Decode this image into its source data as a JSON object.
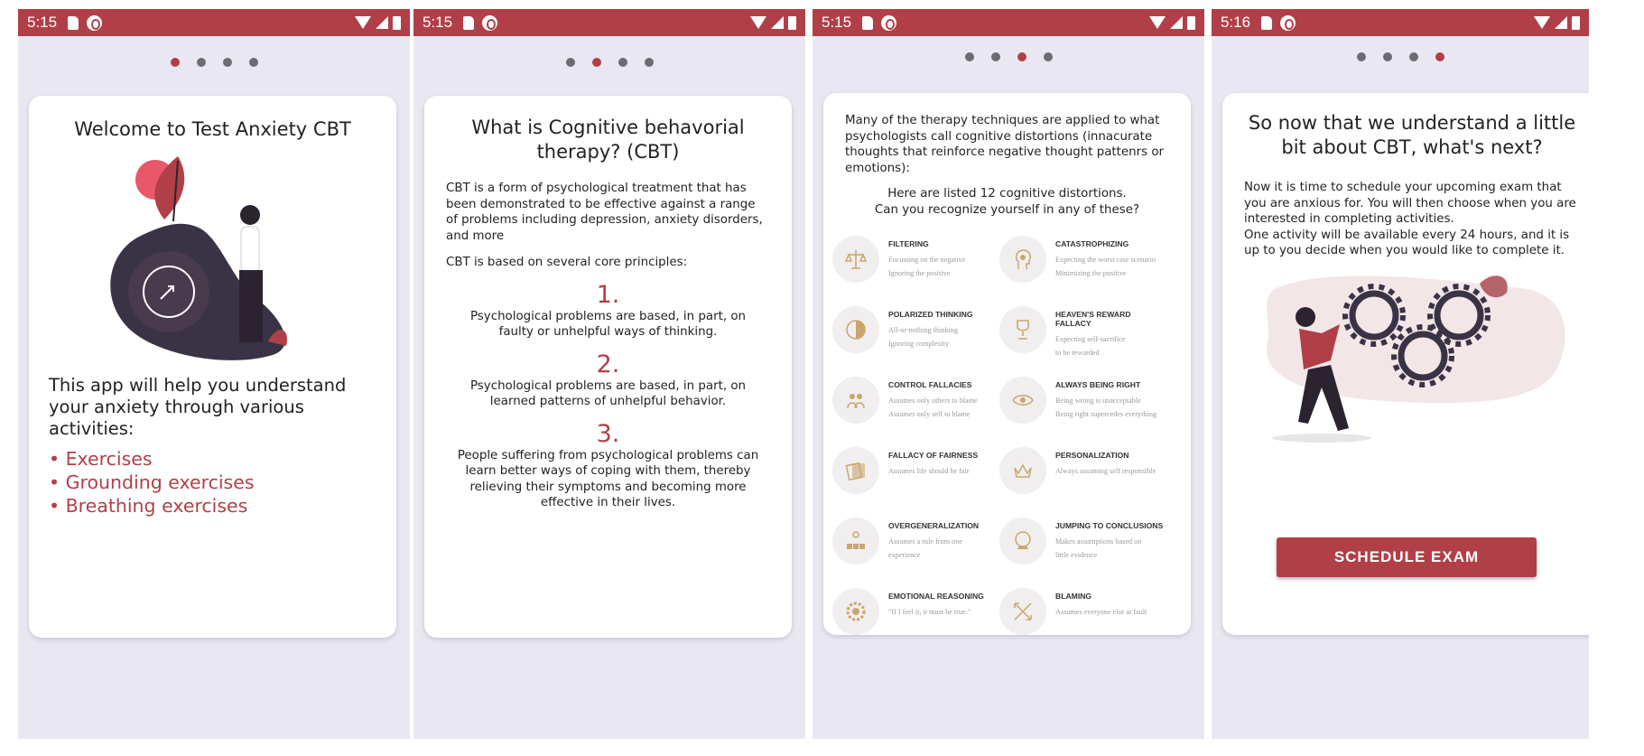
{
  "screens": [
    {
      "time": "5:15",
      "title": "Welcome to Test Anxiety CBT",
      "body": "This app will help you understand your anxiety through various activities:",
      "bullets": [
        "• Exercises",
        "• Grounding exercises",
        "• Breathing exercises"
      ]
    },
    {
      "time": "5:15",
      "title": "What is  Cognitive behavorial therapy? (CBT)",
      "intro": "CBT is a form of psychological treatment that has been demonstrated to be effective against a range of problems including depression, anxiety disorders, and more",
      "core": "CBT is based on several core principles:",
      "principles": [
        {
          "num": "1.",
          "text": "Psychological problems are based, in part, on faulty or unhelpful ways of thinking."
        },
        {
          "num": "2.",
          "text": "Psychological problems are based, in part, on learned patterns of unhelpful behavior."
        },
        {
          "num": "3.",
          "text": "People suffering from psychological problems can learn better ways of coping with them, thereby relieving their symptoms and becoming more effective in their lives."
        }
      ]
    },
    {
      "time": "5:15",
      "intro": "Many of the therapy techniques are applied to what psychologists call cognitive distortions (innacurate thoughts that reinforce negative thought pattenrs or emotions):",
      "heading_line1": "Here are listed 12 cognitive distortions.",
      "heading_line2": "Can you recognize yourself in any of these?",
      "distortions": [
        {
          "name": "FILTERING",
          "l1": "Focussing on the negative",
          "l2": "Ignoring the positive",
          "icon": "scale-icon"
        },
        {
          "name": "CATASTROPHIZING",
          "l1": "Expecting the worst case scenario",
          "l2": "Minimizing the positive",
          "icon": "head-icon"
        },
        {
          "name": "POLARIZED THINKING",
          "l1": "All-or-nothing thinking",
          "l2": "Ignoring complexity",
          "icon": "polar-icon"
        },
        {
          "name": "HEAVEN'S REWARD FALLACY",
          "l1": "Expecting self-sacrifice",
          "l2": "to be rewarded",
          "icon": "trophy-icon"
        },
        {
          "name": "CONTROL FALLACIES",
          "l1": "Assumes only others to blame",
          "l2": "Assumes only self to blame",
          "icon": "people-icon"
        },
        {
          "name": "ALWAYS BEING RIGHT",
          "l1": "Being wrong is unacceptable",
          "l2": "Being right supercedes everything",
          "icon": "eye-icon"
        },
        {
          "name": "FALLACY OF FAIRNESS",
          "l1": "Assumes life should be fair",
          "l2": "",
          "icon": "cards-icon"
        },
        {
          "name": "PERSONALIZATION",
          "l1": "Always assuming self responsible",
          "l2": "",
          "icon": "crown-icon"
        },
        {
          "name": "OVERGENERALIZATION",
          "l1": "Assumes a rule from one",
          "l2": "experience",
          "icon": "boxes-icon"
        },
        {
          "name": "JUMPING TO CONCLUSIONS",
          "l1": "Makes assumptions based on",
          "l2": "little evidence",
          "icon": "crystal-ball-icon"
        },
        {
          "name": "EMOTIONAL REASONING",
          "l1": "\"If I feel it, it must be true.\"",
          "l2": "",
          "icon": "heart-gear-icon"
        },
        {
          "name": "BLAMING",
          "l1": "Assumes everyone else at fault",
          "l2": "",
          "icon": "arrows-icon"
        }
      ]
    },
    {
      "time": "5:16",
      "title": "So now that we understand a little bit about CBT, what's next?",
      "body1": "Now it is time to schedule your upcoming exam that you are anxious for. You will then choose when you are interested in completing activities.",
      "body2": " One activity will be available every 24 hours, and it is up to you decide when you would like to complete it.",
      "button": "SCHEDULE EXAM"
    }
  ],
  "colors": {
    "accent": "#b13f48",
    "background": "#e9e8f2",
    "card": "#ffffff",
    "icon": "#c9a66b"
  }
}
